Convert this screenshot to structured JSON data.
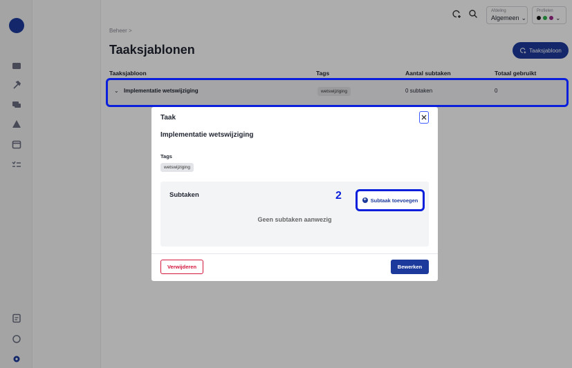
{
  "sidebar": {
    "icons": [
      "inbox-icon",
      "hammer-icon",
      "folders-icon",
      "warning-icon",
      "calendar-icon",
      "checklist-icon",
      "document-icon",
      "chat-icon",
      "settings-icon"
    ]
  },
  "topbar": {
    "department_label": "Afdeling",
    "department_value": "Algemeen",
    "profile_label": "Profielen",
    "profile_colors": [
      "#111111",
      "#2bb24c",
      "#9c2a8c"
    ]
  },
  "breadcrumb": "Beheer >",
  "page_title": "Taaksjablonen",
  "new_template_button": "Taaksjabloon",
  "table": {
    "columns": [
      "Taaksjabloon",
      "Tags",
      "Aantal subtaken",
      "Totaal gebruikt"
    ],
    "rows": [
      {
        "name": "Implementatie wetswijziging",
        "tag": "wetswijziging",
        "subtasks": "0 subtaken",
        "used": "0"
      }
    ]
  },
  "modal": {
    "title": "Taak",
    "task_name": "Implementatie wetswijziging",
    "tags_label": "Tags",
    "tag": "wetswijziging",
    "subtasks_title": "Subtaken",
    "step_number": "2",
    "add_subtask_button": "Subtaak toevoegen",
    "empty_text": "Geen subtaken aanwezig",
    "delete_button": "Verwijderen",
    "edit_button": "Bewerken"
  },
  "colors": {
    "primary": "#1c3a9c",
    "highlight": "#0a1fdc",
    "danger": "#d3153b"
  }
}
